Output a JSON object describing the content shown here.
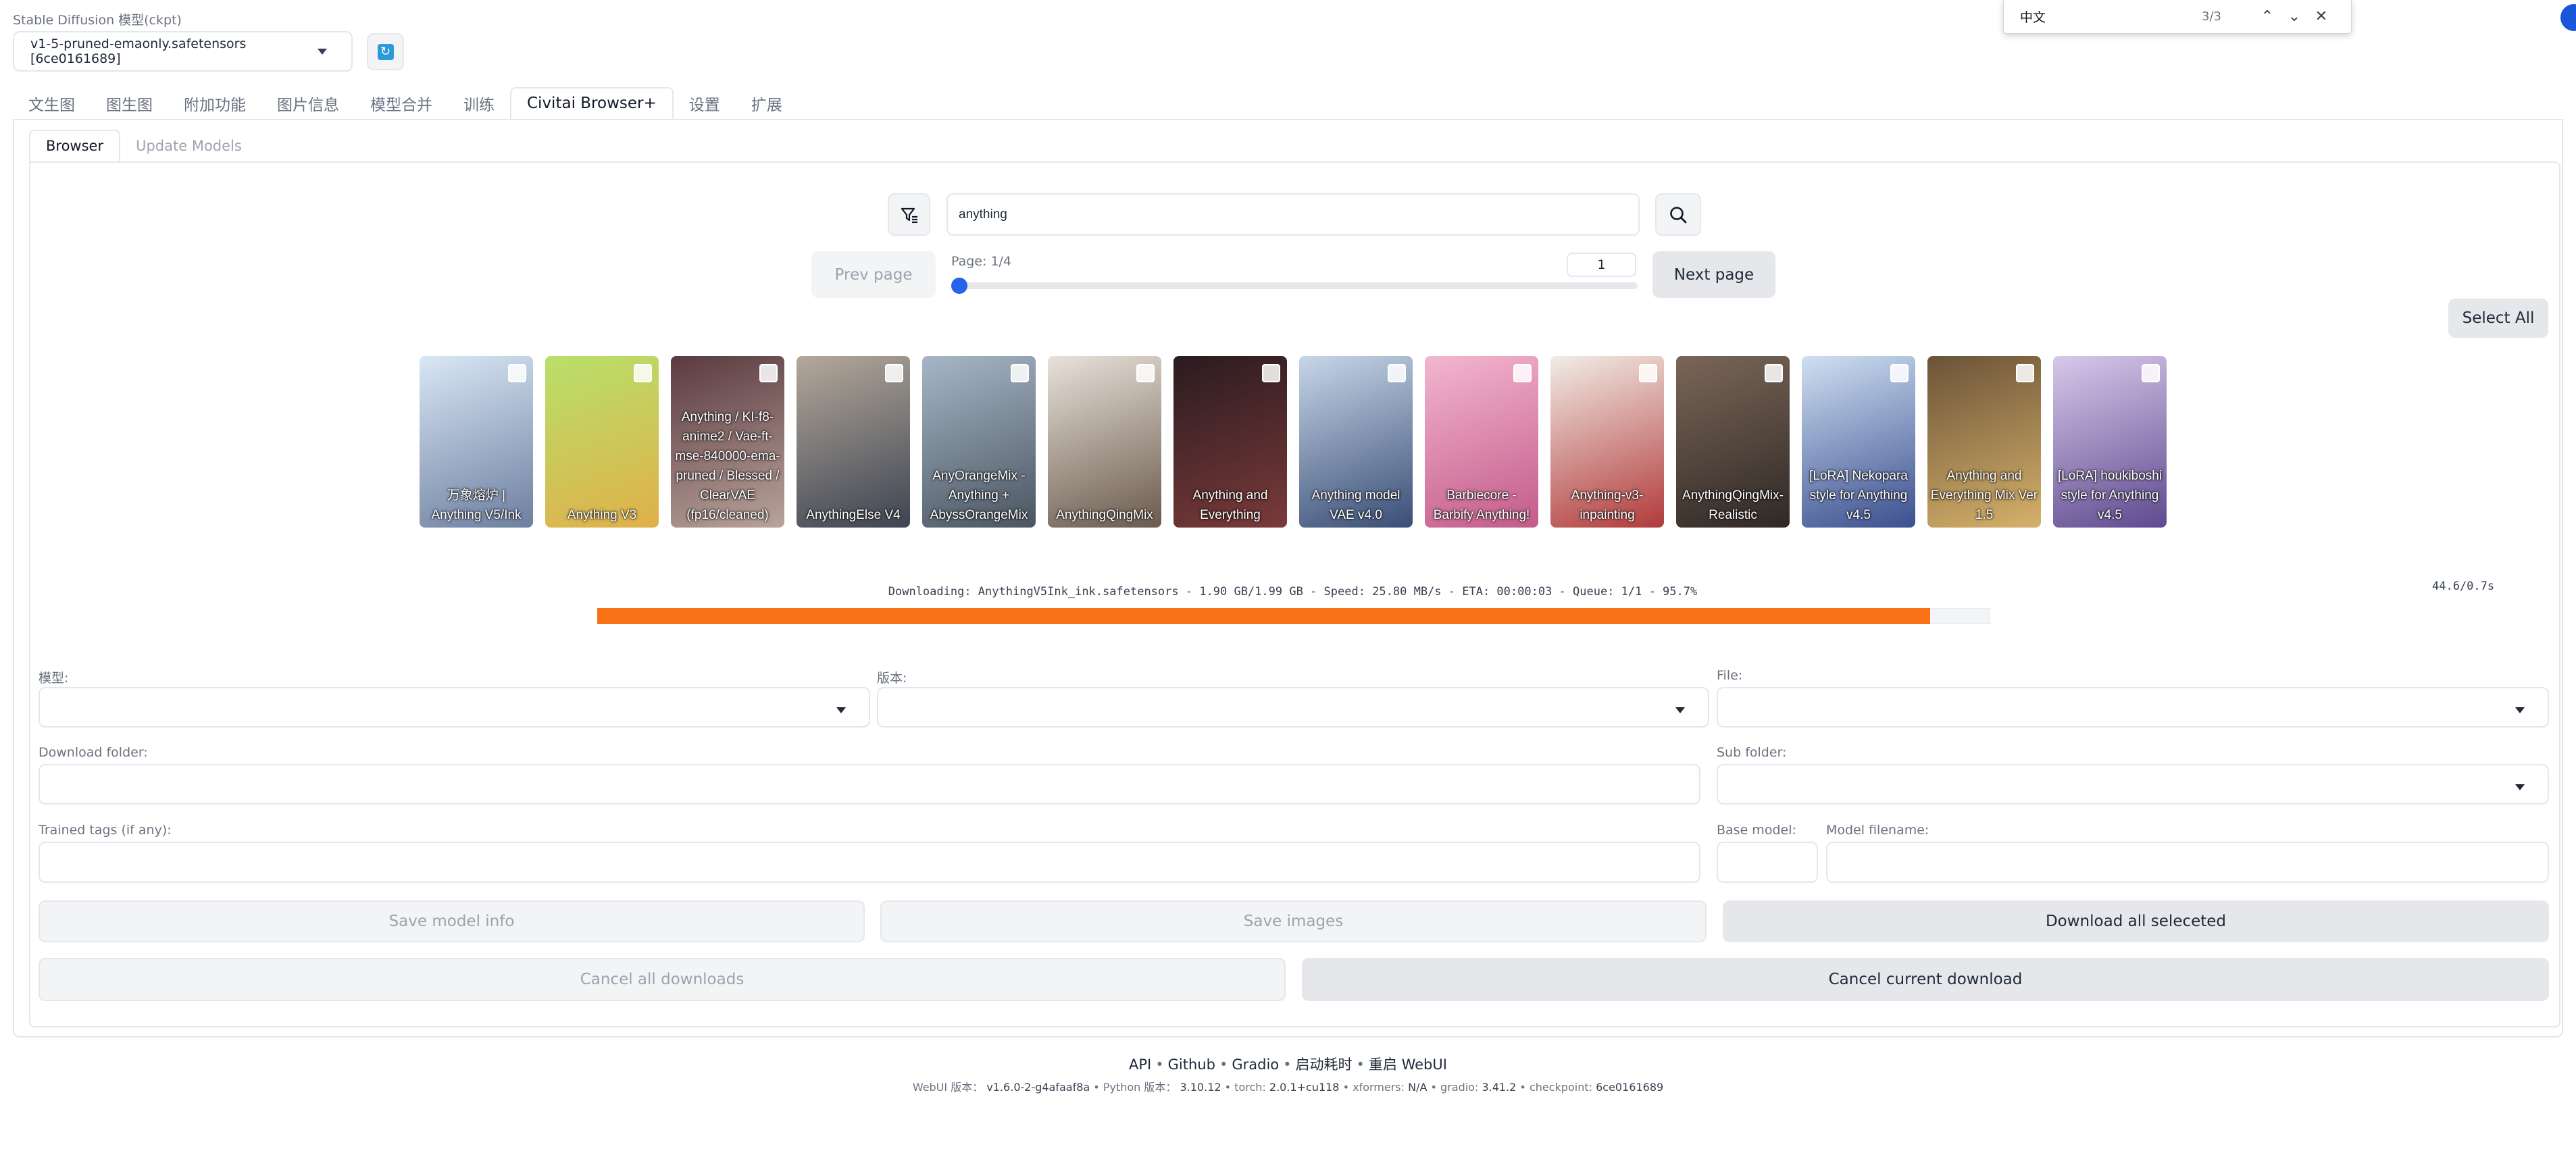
{
  "model": {
    "label": "Stable Diffusion 模型(ckpt)",
    "value": "v1-5-pruned-emaonly.safetensors [6ce0161689]"
  },
  "findbar": {
    "query": "中文",
    "count": "3/3"
  },
  "main_tabs": [
    "文生图",
    "图生图",
    "附加功能",
    "图片信息",
    "模型合并",
    "训练",
    "Civitai Browser+",
    "设置",
    "扩展"
  ],
  "active_main_tab": "Civitai Browser+",
  "sub_tabs": [
    "Browser",
    "Update Models"
  ],
  "search": {
    "value": "anything"
  },
  "pagination": {
    "prev": "Prev page",
    "label": "Page: 1/4",
    "page": "1",
    "next": "Next page",
    "current": 1,
    "total": 4
  },
  "select_all": "Select All",
  "cards": [
    {
      "caption": "万象熔炉 | Anything V5/Ink",
      "c1": "#d9e7f5",
      "c2": "#6d7fa0"
    },
    {
      "caption": "Anything V3",
      "c1": "#b8e06a",
      "c2": "#e0b04a"
    },
    {
      "caption": "Anything / KI-f8-anime2 / Vae-ft-mse-840000-ema-pruned / Blessed / ClearVAE (fp16/cleaned)",
      "c1": "#5a3a3f",
      "c2": "#b9a39b"
    },
    {
      "caption": "AnythingElse V4",
      "c1": "#b4a89a",
      "c2": "#3d4452"
    },
    {
      "caption": "AnyOrangeMix - Anything + AbyssOrangeMix",
      "c1": "#a7b6c6",
      "c2": "#4a5561"
    },
    {
      "caption": "AnythingQingMix",
      "c1": "#e8e2da",
      "c2": "#6b5a4d"
    },
    {
      "caption": "Anything and Everything",
      "c1": "#2a1b1f",
      "c2": "#7a3a3a"
    },
    {
      "caption": "Anything model VAE v4.0",
      "c1": "#c7d6e8",
      "c2": "#3a4e76"
    },
    {
      "caption": "Barbiecore - Barbify Anything!",
      "c1": "#f3b6cf",
      "c2": "#c35b8a"
    },
    {
      "caption": "Anything-v3-inpainting",
      "c1": "#f2ece6",
      "c2": "#b13b3b"
    },
    {
      "caption": "AnythingQingMix-Realistic",
      "c1": "#7a6658",
      "c2": "#2f2925"
    },
    {
      "caption": "[LoRA] Nekopara style for Anything v4.5",
      "c1": "#cfe0f2",
      "c2": "#3b4f8f"
    },
    {
      "caption": "Anything and Everything Mix Ver 1.5",
      "c1": "#6b5338",
      "c2": "#d6b16a"
    },
    {
      "caption": "[LoRA] houkiboshi style for Anything v4.5",
      "c1": "#d8c8ea",
      "c2": "#5e4a8f"
    }
  ],
  "download": {
    "status": "Downloading: AnythingV5Ink_ink.safetensors - 1.90 GB/1.99 GB - Speed: 25.80 MB/s - ETA: 00:00:03 - Queue: 1/1 - 95.7%",
    "progress": 0.957,
    "timer": "44.6/0.7s",
    "accent": "#f97316"
  },
  "form": {
    "model_label": "模型:",
    "version_label": "版本:",
    "file_label": "File:",
    "download_folder_label": "Download folder:",
    "sub_folder_label": "Sub folder:",
    "trained_tags_label": "Trained tags (if any):",
    "base_model_label": "Base model:",
    "model_filename_label": "Model filename:"
  },
  "buttons": {
    "save_model_info": "Save model info",
    "save_images": "Save images",
    "download_all": "Download all seleceted",
    "cancel_all": "Cancel all downloads",
    "cancel_current": "Cancel current download"
  },
  "footer": {
    "links": [
      "API",
      "Github",
      "Gradio",
      "启动耗时",
      "重启 WebUI"
    ],
    "info": [
      {
        "k": "WebUI 版本：",
        "v": "v1.6.0-2-g4afaaf8a"
      },
      {
        "k": "Python 版本：",
        "v": "3.10.12"
      },
      {
        "k": "torch:",
        "v": "2.0.1+cu118"
      },
      {
        "k": "xformers:",
        "v": "N/A"
      },
      {
        "k": "gradio:",
        "v": "3.41.2"
      },
      {
        "k": "checkpoint:",
        "v": "6ce0161689"
      }
    ]
  }
}
